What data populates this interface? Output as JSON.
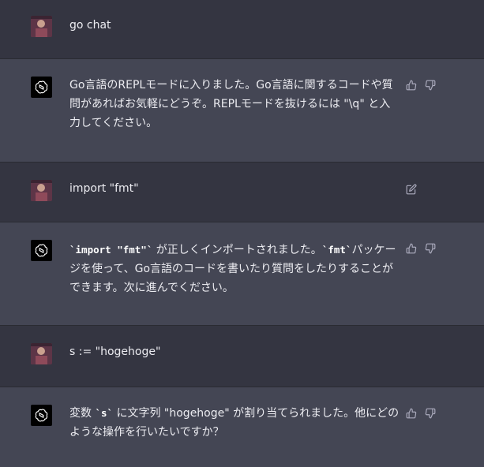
{
  "colors": {
    "user_row_bg": "#343541",
    "assistant_row_bg": "#444654",
    "text": "#ececf1",
    "icon": "#acacbe"
  },
  "messages": [
    {
      "role": "user",
      "text": "go chat",
      "avatar": "user-avatar"
    },
    {
      "role": "assistant",
      "avatar": "openai-logo-icon",
      "parts": [
        {
          "t": "text",
          "v": "Go言語のREPLモードに入りました。Go言語に関するコードや質問があればお気軽にどうぞ。REPLモードを抜けるには \""
        },
        {
          "t": "text",
          "v": "\\q"
        },
        {
          "t": "text",
          "v": "\" と入力してください。"
        }
      ],
      "icons": [
        "thumbs-up-icon",
        "thumbs-down-icon"
      ]
    },
    {
      "role": "user",
      "text": "import \"fmt\"",
      "avatar": "user-avatar",
      "icons": [
        "edit-icon"
      ]
    },
    {
      "role": "assistant",
      "avatar": "openai-logo-icon",
      "parts": [
        {
          "t": "code",
          "v": "`import \"fmt\"`"
        },
        {
          "t": "text",
          "v": " が正しくインポートされました。"
        },
        {
          "t": "code",
          "v": "`fmt`"
        },
        {
          "t": "text",
          "v": "パッケージを使って、Go言語のコードを書いたり質問をしたりすることができます。次に進んでください。"
        }
      ],
      "icons": [
        "thumbs-up-icon",
        "thumbs-down-icon"
      ]
    },
    {
      "role": "user",
      "text": "s := \"hogehoge\"",
      "avatar": "user-avatar"
    },
    {
      "role": "assistant",
      "avatar": "openai-logo-icon",
      "parts": [
        {
          "t": "text",
          "v": "変数 "
        },
        {
          "t": "code",
          "v": "`s`"
        },
        {
          "t": "text",
          "v": " に文字列 \"hogehoge\" が割り当てられました。他にどのような操作を行いたいですか？"
        }
      ],
      "icons": [
        "thumbs-up-icon",
        "thumbs-down-icon"
      ]
    }
  ]
}
